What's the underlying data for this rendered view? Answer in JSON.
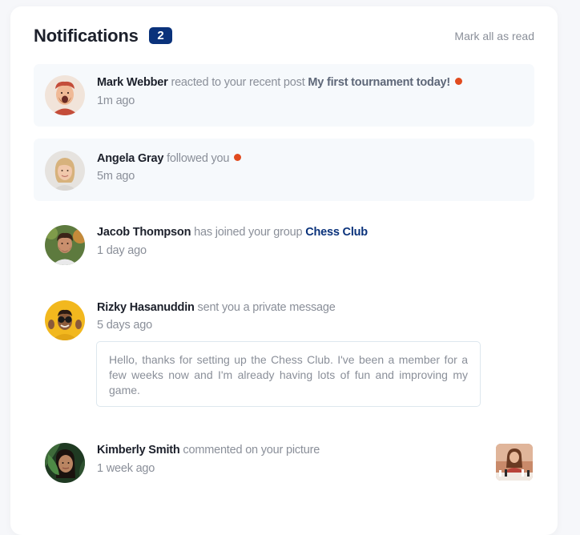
{
  "header": {
    "title": "Notifications",
    "unread_count": "2",
    "mark_all_label": "Mark all as read"
  },
  "notifications": [
    {
      "name": "Mark Webber",
      "action": "reacted to your recent post",
      "target": "My first tournament today!",
      "time": "1m ago",
      "unread": true
    },
    {
      "name": "Angela Gray",
      "action": "followed you",
      "time": "5m ago",
      "unread": true
    },
    {
      "name": "Jacob Thompson",
      "action": "has joined your group",
      "target": "Chess Club",
      "time": "1 day ago",
      "unread": false
    },
    {
      "name": "Rizky Hasanuddin",
      "action": "sent you a private message",
      "time": "5 days ago",
      "message": "Hello, thanks for setting up the Chess Club. I've been a member for a few weeks now and I'm already having lots of fun and improving my game.",
      "unread": false
    },
    {
      "name": "Kimberly Smith",
      "action": "commented on your picture",
      "time": "1 week ago",
      "unread": false
    }
  ],
  "colors": {
    "badge": "#0a327b",
    "unread_dot": "#e14b1f",
    "unread_bg": "#f6f9fc",
    "name": "#1c202b",
    "muted": "#8a8f99"
  }
}
